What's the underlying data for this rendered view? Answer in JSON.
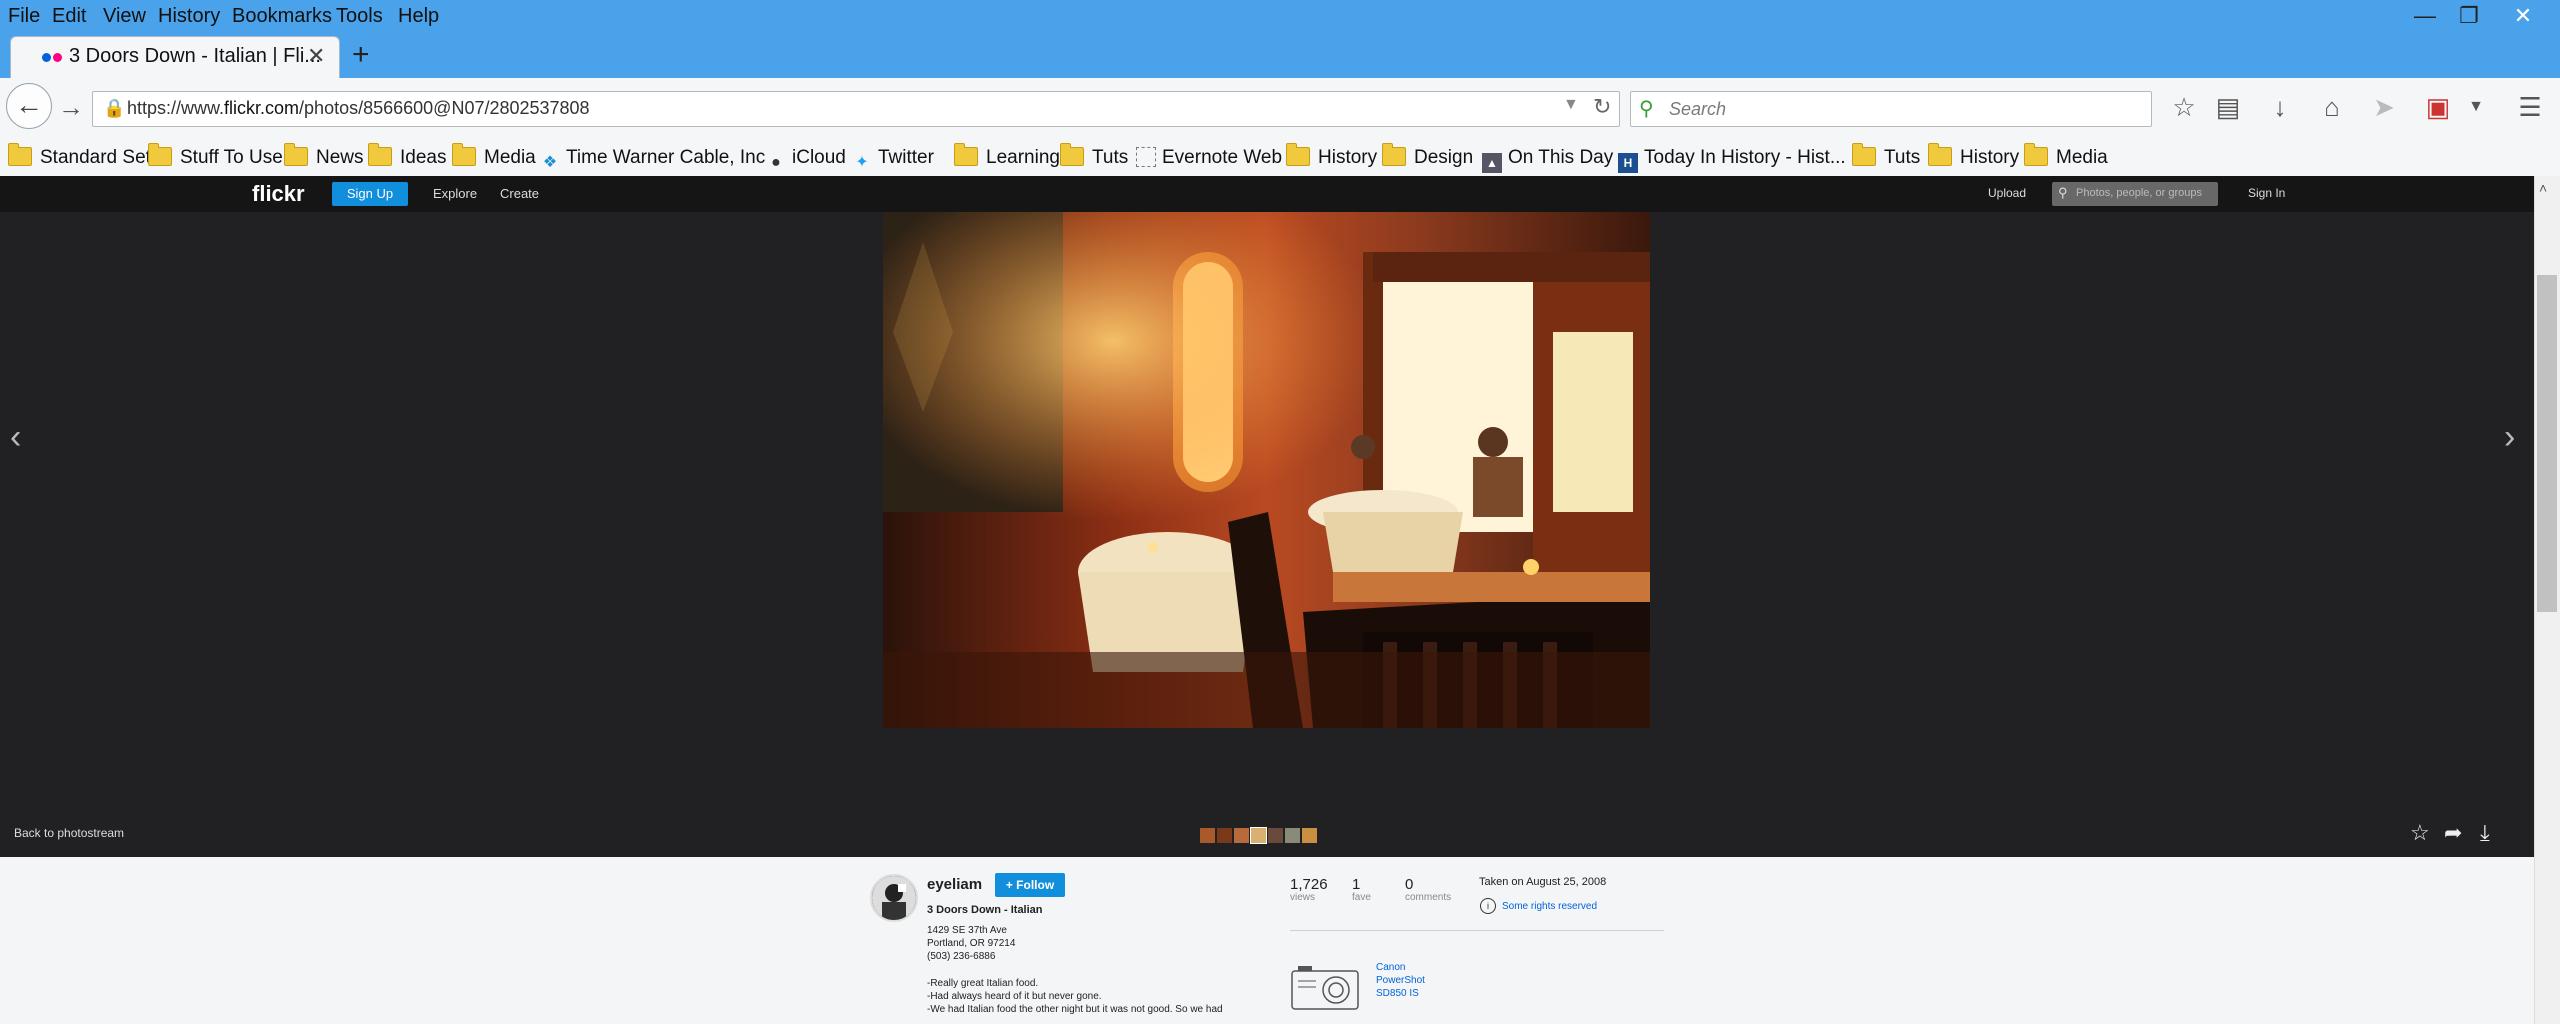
{
  "menubar": [
    "File",
    "Edit",
    "View",
    "History",
    "Bookmarks",
    "Tools",
    "Help"
  ],
  "tab": {
    "title": "3 Doors Down - Italian | Fli...",
    "new_tab": "+"
  },
  "urlbar": {
    "prefix": "https://www.",
    "domain": "flickr.com",
    "path": "/photos/8566600@N07/2802537808"
  },
  "search": {
    "placeholder": "Search"
  },
  "bookmarks": [
    {
      "label": "Standard Set",
      "type": "folder"
    },
    {
      "label": "Stuff To Use",
      "type": "folder"
    },
    {
      "label": "News",
      "type": "folder"
    },
    {
      "label": "Ideas",
      "type": "folder"
    },
    {
      "label": "Media",
      "type": "folder"
    },
    {
      "label": "Time Warner Cable, Inc",
      "type": "site"
    },
    {
      "label": "iCloud",
      "type": "site"
    },
    {
      "label": "Twitter",
      "type": "site"
    },
    {
      "label": "Learning",
      "type": "folder"
    },
    {
      "label": "Tuts",
      "type": "folder"
    },
    {
      "label": "Evernote Web",
      "type": "site"
    },
    {
      "label": "History",
      "type": "folder"
    },
    {
      "label": "Design",
      "type": "folder"
    },
    {
      "label": "On This Day",
      "type": "site"
    },
    {
      "label": "Today In History - Hist...",
      "type": "site"
    },
    {
      "label": "Tuts",
      "type": "folder"
    },
    {
      "label": "History",
      "type": "folder"
    },
    {
      "label": "Media",
      "type": "folder"
    }
  ],
  "flickr_nav": {
    "logo": "flickr",
    "sign_up": "Sign Up",
    "explore": "Explore",
    "create": "Create",
    "upload": "Upload",
    "search_placeholder": "Photos, people, or groups",
    "sign_in": "Sign In"
  },
  "photo_page": {
    "back": "Back to photostream"
  },
  "owner": {
    "name": "eyeliam",
    "follow": "+ Follow"
  },
  "photo_info": {
    "title": "3 Doors Down - Italian",
    "address1": "1429 SE 37th Ave",
    "address2": "Portland, OR 97214",
    "phone": "(503) 236-6886",
    "desc1": "-Really great Italian food.",
    "desc2": "-Had always heard of it but never gone.",
    "desc3": "-We had Italian food the other night but it was not good. So we had"
  },
  "stats": {
    "views": "1,726",
    "views_label": "views",
    "faves": "1",
    "faves_label": "fave",
    "comments": "0",
    "comments_label": "comments"
  },
  "taken": "Taken on August 25, 2008",
  "license": "Some rights reserved",
  "camera": {
    "line1": "Canon",
    "line2": "PowerShot",
    "line3": "SD850 IS"
  }
}
